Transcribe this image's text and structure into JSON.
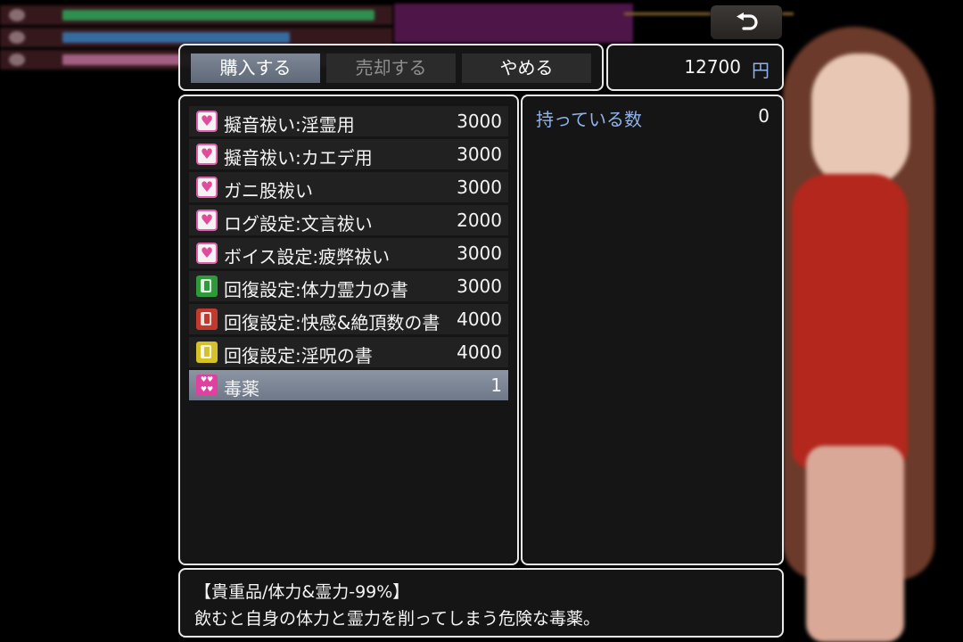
{
  "commands": [
    {
      "label": "購入する",
      "active": true
    },
    {
      "label": "売却する",
      "active": false
    },
    {
      "label": "やめる",
      "active": false
    }
  ],
  "gold": {
    "amount": "12700",
    "unit": "円"
  },
  "items": [
    {
      "icon": "heart-icon",
      "name": "擬音祓い:淫霊用",
      "price": "3000"
    },
    {
      "icon": "heart-icon",
      "name": "擬音祓い:カエデ用",
      "price": "3000"
    },
    {
      "icon": "heart-icon",
      "name": "ガニ股祓い",
      "price": "3000"
    },
    {
      "icon": "heart-icon",
      "name": "ログ設定:文言祓い",
      "price": "2000"
    },
    {
      "icon": "heart-icon",
      "name": "ボイス設定:疲弊祓い",
      "price": "3000"
    },
    {
      "icon": "green-book-icon",
      "name": "回復設定:体力霊力の書",
      "price": "3000"
    },
    {
      "icon": "red-book-icon",
      "name": "回復設定:快感&絶頂数の書",
      "price": "4000"
    },
    {
      "icon": "yellow-book-icon",
      "name": "回復設定:淫呪の書",
      "price": "4000"
    },
    {
      "icon": "poison-icon",
      "name": "毒薬",
      "price": "1",
      "selected": true
    }
  ],
  "status": {
    "label": "持っている数",
    "value": "0"
  },
  "help": {
    "line1": "【貴重品/体力&霊力-99%】",
    "line2": "飲むと自身の体力と霊力を削ってしまう危険な毒薬。"
  },
  "back_button": {
    "icon": "undo-arrow-icon"
  },
  "colors": {
    "accent_blue": "#8fb3ea",
    "heart_pink": "#e24a9b",
    "selection": "#7d8796",
    "window_bg": "#161616"
  }
}
